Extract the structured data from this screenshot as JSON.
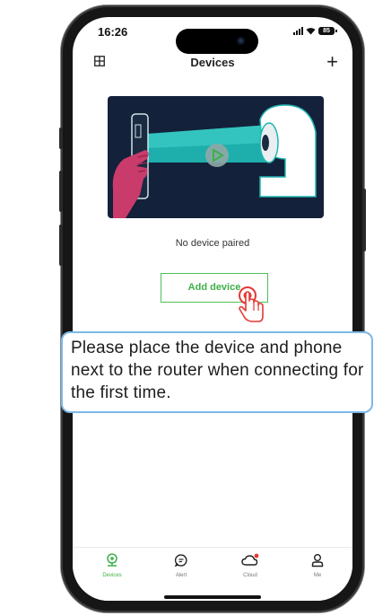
{
  "status": {
    "time": "16:26",
    "battery": "85"
  },
  "header": {
    "title": "Devices",
    "left_icon": "grid-icon",
    "right_icon": "plus-icon"
  },
  "main": {
    "empty_message": "No device paired",
    "add_button_label": "Add device"
  },
  "tabbar": {
    "items": [
      {
        "label": "Devices",
        "icon": "camera-icon",
        "active": true
      },
      {
        "label": "Alert",
        "icon": "message-icon",
        "active": false
      },
      {
        "label": "Cloud",
        "icon": "cloud-icon",
        "active": false,
        "badge": true
      },
      {
        "label": "Me",
        "icon": "person-icon",
        "active": false
      }
    ]
  },
  "callout": {
    "text": "Please place the device and phone next to the router when connecting for the first time."
  },
  "colors": {
    "accent": "#3db049",
    "callout_border": "#7db8e6",
    "badge": "#e53935",
    "illustration_bg": "#14213a"
  }
}
